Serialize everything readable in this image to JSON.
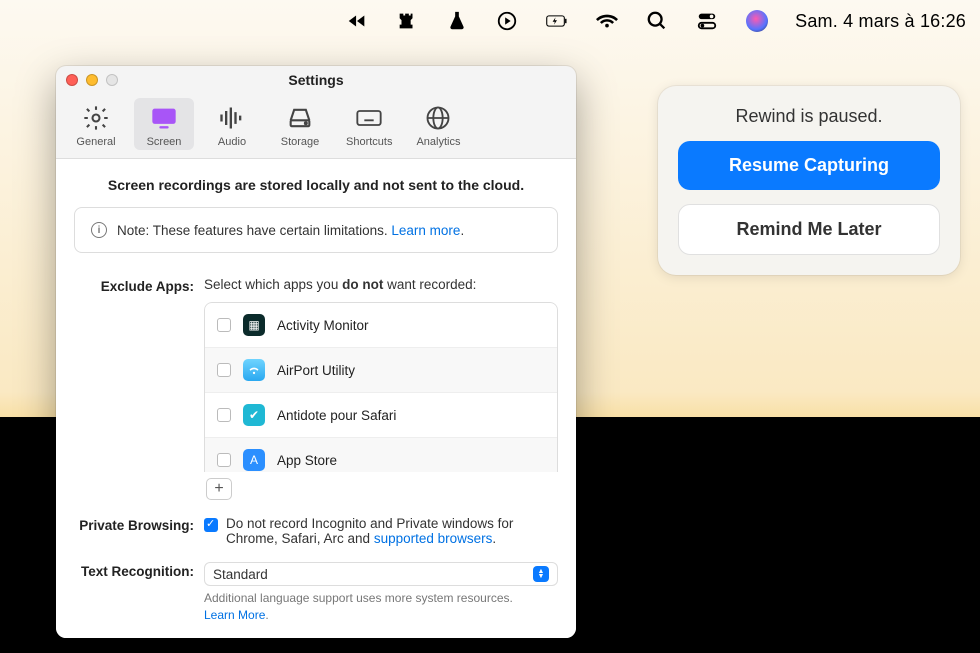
{
  "menubar": {
    "datetime": "Sam. 4 mars à 16:26"
  },
  "window": {
    "title": "Settings",
    "tabs": [
      {
        "label": "General"
      },
      {
        "label": "Screen"
      },
      {
        "label": "Audio"
      },
      {
        "label": "Storage"
      },
      {
        "label": "Shortcuts"
      },
      {
        "label": "Analytics"
      }
    ],
    "headline": "Screen recordings are stored locally and not sent to the cloud.",
    "note_prefix": "Note: These features have certain limitations. ",
    "note_link": "Learn more",
    "note_suffix": ".",
    "exclude_label": "Exclude Apps:",
    "exclude_desc_pre": "Select which apps you ",
    "exclude_desc_bold": "do not",
    "exclude_desc_post": " want recorded:",
    "apps": [
      {
        "name": "Activity Monitor",
        "icon_bg": "#0b2b2b"
      },
      {
        "name": "AirPort Utility",
        "icon_bg": "#3dbaf7"
      },
      {
        "name": "Antidote pour Safari",
        "icon_bg": "#1fb8d4"
      },
      {
        "name": "App Store",
        "icon_bg": "#2b8fff"
      }
    ],
    "add_label": "+",
    "private_label": "Private Browsing:",
    "private_text_pre": "Do not record Incognito and Private windows for Chrome, Safari, Arc and ",
    "private_link": "supported browsers",
    "private_text_post": ".",
    "private_checked": true,
    "ocr_label": "Text Recognition:",
    "ocr_value": "Standard",
    "ocr_help_pre": "Additional language support uses more system resources. ",
    "ocr_help_link": "Learn More",
    "ocr_help_post": "."
  },
  "notif": {
    "title": "Rewind is paused.",
    "primary": "Resume Capturing",
    "secondary": "Remind Me Later"
  }
}
